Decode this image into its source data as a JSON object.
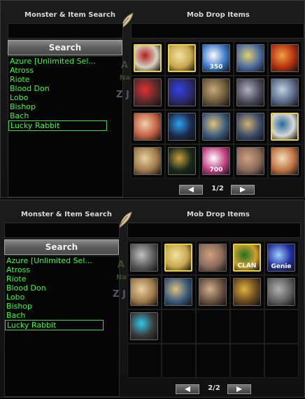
{
  "panels": [
    {
      "search_title": "Monster & Item Search",
      "drop_title": "Mob Drop Items",
      "search_button": "Search",
      "monsters": [
        "Azure [Unlimited Sel...",
        "Atross",
        "Riote",
        "Blood Don",
        "Lobo",
        "Bishop",
        "Bach",
        "Lucky Rabbit"
      ],
      "selected": "Lucky Rabbit",
      "page": "1/2",
      "items": [
        {
          "name": "bird-scroll-icon",
          "bg": "#d8d2c0",
          "fg": "#b02020",
          "label": "",
          "hl": true
        },
        {
          "name": "gold-ticket-icon",
          "bg": "#c9a850",
          "fg": "#f2e2a0",
          "label": "",
          "hl": true
        },
        {
          "name": "kc-350-icon",
          "bg": "#3a78c8",
          "fg": "#ffffff",
          "label": "350",
          "hl": false
        },
        {
          "name": "sword-icon",
          "bg": "#4a6aa0",
          "fg": "#e0d070",
          "label": "",
          "hl": false
        },
        {
          "name": "star-orb-icon",
          "bg": "#b03010",
          "fg": "#f2a040",
          "label": "",
          "hl": false
        },
        {
          "name": "red-potion-icon",
          "bg": "#5a2a2a",
          "fg": "#e03030",
          "label": "",
          "hl": false
        },
        {
          "name": "blue-potion-icon",
          "bg": "#2a2a6a",
          "fg": "#3040e0",
          "label": "",
          "hl": false
        },
        {
          "name": "scroll-icon",
          "bg": "#6a5a3a",
          "fg": "#c8a878",
          "label": "",
          "hl": false
        },
        {
          "name": "scroll-icon",
          "bg": "#4a4a5a",
          "fg": "#b0b0c0",
          "label": "",
          "hl": false
        },
        {
          "name": "rune-scroll-icon",
          "bg": "#5a6a8a",
          "fg": "#c0d0e0",
          "label": "",
          "hl": false
        },
        {
          "name": "fire-scroll-icon",
          "bg": "#c06040",
          "fg": "#f0d0b0",
          "label": "",
          "hl": false
        },
        {
          "name": "blue-whip-icon",
          "bg": "#1a2a4a",
          "fg": "#30a0f0",
          "label": "",
          "hl": false
        },
        {
          "name": "map-scroll-icon",
          "bg": "#3a5a7a",
          "fg": "#e0c080",
          "label": "",
          "hl": false
        },
        {
          "name": "map-scroll-icon",
          "bg": "#3a4a6a",
          "fg": "#d0b070",
          "label": "",
          "hl": false
        },
        {
          "name": "rune-stone-icon",
          "bg": "#d8d8d8",
          "fg": "#2a6a9a",
          "label": "",
          "hl": true
        },
        {
          "name": "parchment-icon",
          "bg": "#a07a4a",
          "fg": "#e8d0a0",
          "label": "",
          "hl": false
        },
        {
          "name": "key-icon",
          "bg": "#1a2a1a",
          "fg": "#c8a040",
          "label": "",
          "hl": false
        },
        {
          "name": "kc-700-icon",
          "bg": "#c04080",
          "fg": "#ffffff",
          "label": "700",
          "hl": false
        },
        {
          "name": "portrait-icon",
          "bg": "#8a6a5a",
          "fg": "#d0a080",
          "label": "",
          "hl": false
        },
        {
          "name": "crystal-scroll-icon",
          "bg": "#c07040",
          "fg": "#f0e0c0",
          "label": "",
          "hl": false
        }
      ]
    },
    {
      "search_title": "Monster & Item Search",
      "drop_title": "Mob Drop Items",
      "search_button": "Search",
      "monsters": [
        "Azure [Unlimited Sel...",
        "Atross",
        "Riote",
        "Blood Don",
        "Lobo",
        "Bishop",
        "Bach",
        "Lucky Rabbit"
      ],
      "selected": "Lucky Rabbit",
      "page": "2/2",
      "items": [
        {
          "name": "warrior-portrait-icon",
          "bg": "#5a5a5a",
          "fg": "#c0c0c0",
          "label": "",
          "hl": false
        },
        {
          "name": "gold-ticket-icon",
          "bg": "#c9a850",
          "fg": "#f2e2a0",
          "label": "",
          "hl": true
        },
        {
          "name": "female-portrait-icon",
          "bg": "#8a6a5a",
          "fg": "#d0a080",
          "label": "",
          "hl": false
        },
        {
          "name": "clan-icon",
          "bg": "#d0a030",
          "fg": "#207020",
          "label": "CLAN",
          "hl": true
        },
        {
          "name": "genie-icon",
          "bg": "#2030a0",
          "fg": "#a0d0ff",
          "label": "Genie",
          "hl": false
        },
        {
          "name": "parchment-icon",
          "bg": "#a07a4a",
          "fg": "#e8d0a0",
          "label": "",
          "hl": false
        },
        {
          "name": "map-scroll-icon",
          "bg": "#3a5a7a",
          "fg": "#e0c080",
          "label": "",
          "hl": false
        },
        {
          "name": "armor-icon",
          "bg": "#6a5040",
          "fg": "#d0b090",
          "label": "",
          "hl": false
        },
        {
          "name": "treasure-chest-icon",
          "bg": "#6a4a20",
          "fg": "#e0b040",
          "label": "",
          "hl": false
        },
        {
          "name": "stone-chest-icon",
          "bg": "#606060",
          "fg": "#b0b0b0",
          "label": "",
          "hl": false
        },
        {
          "name": "gem-icon",
          "bg": "#3a3a3a",
          "fg": "#30c8e8",
          "label": "",
          "hl": false
        }
      ]
    }
  ],
  "bg_labels": [
    "A",
    "Nav",
    "Z J"
  ]
}
